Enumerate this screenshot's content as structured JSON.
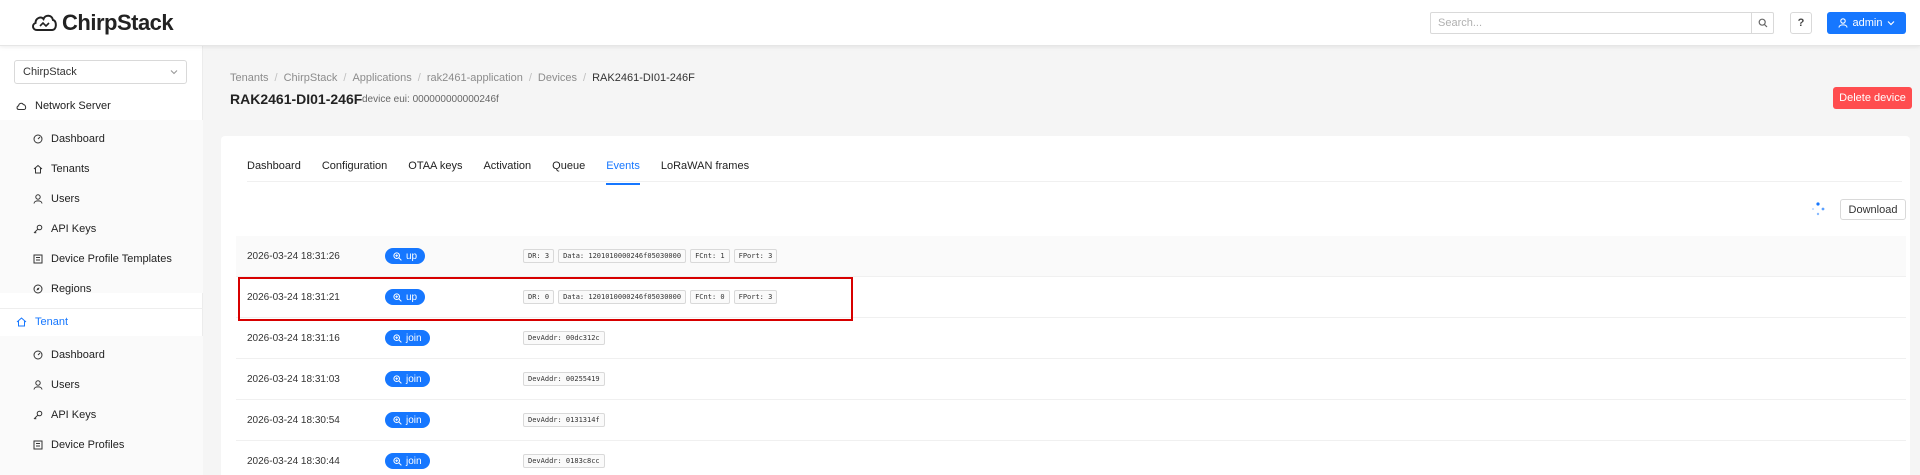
{
  "header": {
    "brand": "ChirpStack",
    "search": {
      "placeholder": "Search...",
      "value": ""
    },
    "help_label": "?",
    "user_label": "admin"
  },
  "sidebar": {
    "tenant_select": "ChirpStack",
    "network_server": {
      "label": "Network Server",
      "items": [
        {
          "label": "Dashboard",
          "icon": "dashboard-icon"
        },
        {
          "label": "Tenants",
          "icon": "tenants-icon"
        },
        {
          "label": "Users",
          "icon": "user-icon"
        },
        {
          "label": "API Keys",
          "icon": "key-icon"
        },
        {
          "label": "Device Profile Templates",
          "icon": "profile-template-icon"
        },
        {
          "label": "Regions",
          "icon": "compass-icon"
        }
      ]
    },
    "tenant": {
      "label": "Tenant",
      "items": [
        {
          "label": "Dashboard",
          "icon": "dashboard-icon"
        },
        {
          "label": "Users",
          "icon": "user-icon"
        },
        {
          "label": "API Keys",
          "icon": "key-icon"
        },
        {
          "label": "Device Profiles",
          "icon": "profile-icon"
        }
      ]
    }
  },
  "breadcrumb": [
    "Tenants",
    "ChirpStack",
    "Applications",
    "rak2461-application",
    "Devices",
    "RAK2461-DI01-246F"
  ],
  "page": {
    "title": "RAK2461-DI01-246F",
    "eui": "device eui: 000000000000246f",
    "delete_label": "Delete device"
  },
  "tabs": [
    "Dashboard",
    "Configuration",
    "OTAA keys",
    "Activation",
    "Queue",
    "Events",
    "LoRaWAN frames"
  ],
  "active_tab": "Events",
  "download_label": "Download",
  "events": [
    {
      "time": "2026-03-24 18:31:26",
      "type": "up",
      "tags": [
        "DR: 3",
        "Data: 1201010000246f05030000",
        "FCnt: 1",
        "FPort: 3"
      ]
    },
    {
      "time": "2026-03-24 18:31:21",
      "type": "up",
      "tags": [
        "DR: 0",
        "Data: 1201010000246f05030000",
        "FCnt: 0",
        "FPort: 3"
      ]
    },
    {
      "time": "2026-03-24 18:31:16",
      "type": "join",
      "tags": [
        "DevAddr: 00dc312c"
      ]
    },
    {
      "time": "2026-03-24 18:31:03",
      "type": "join",
      "tags": [
        "DevAddr: 00255419"
      ]
    },
    {
      "time": "2026-03-24 18:30:54",
      "type": "join",
      "tags": [
        "DevAddr: 0131314f"
      ]
    },
    {
      "time": "2026-03-24 18:30:44",
      "type": "join",
      "tags": [
        "DevAddr: 0183c8cc"
      ]
    }
  ],
  "colors": {
    "primary": "#1677ff",
    "danger": "#ff4d4f",
    "highlight": "#d70000"
  }
}
